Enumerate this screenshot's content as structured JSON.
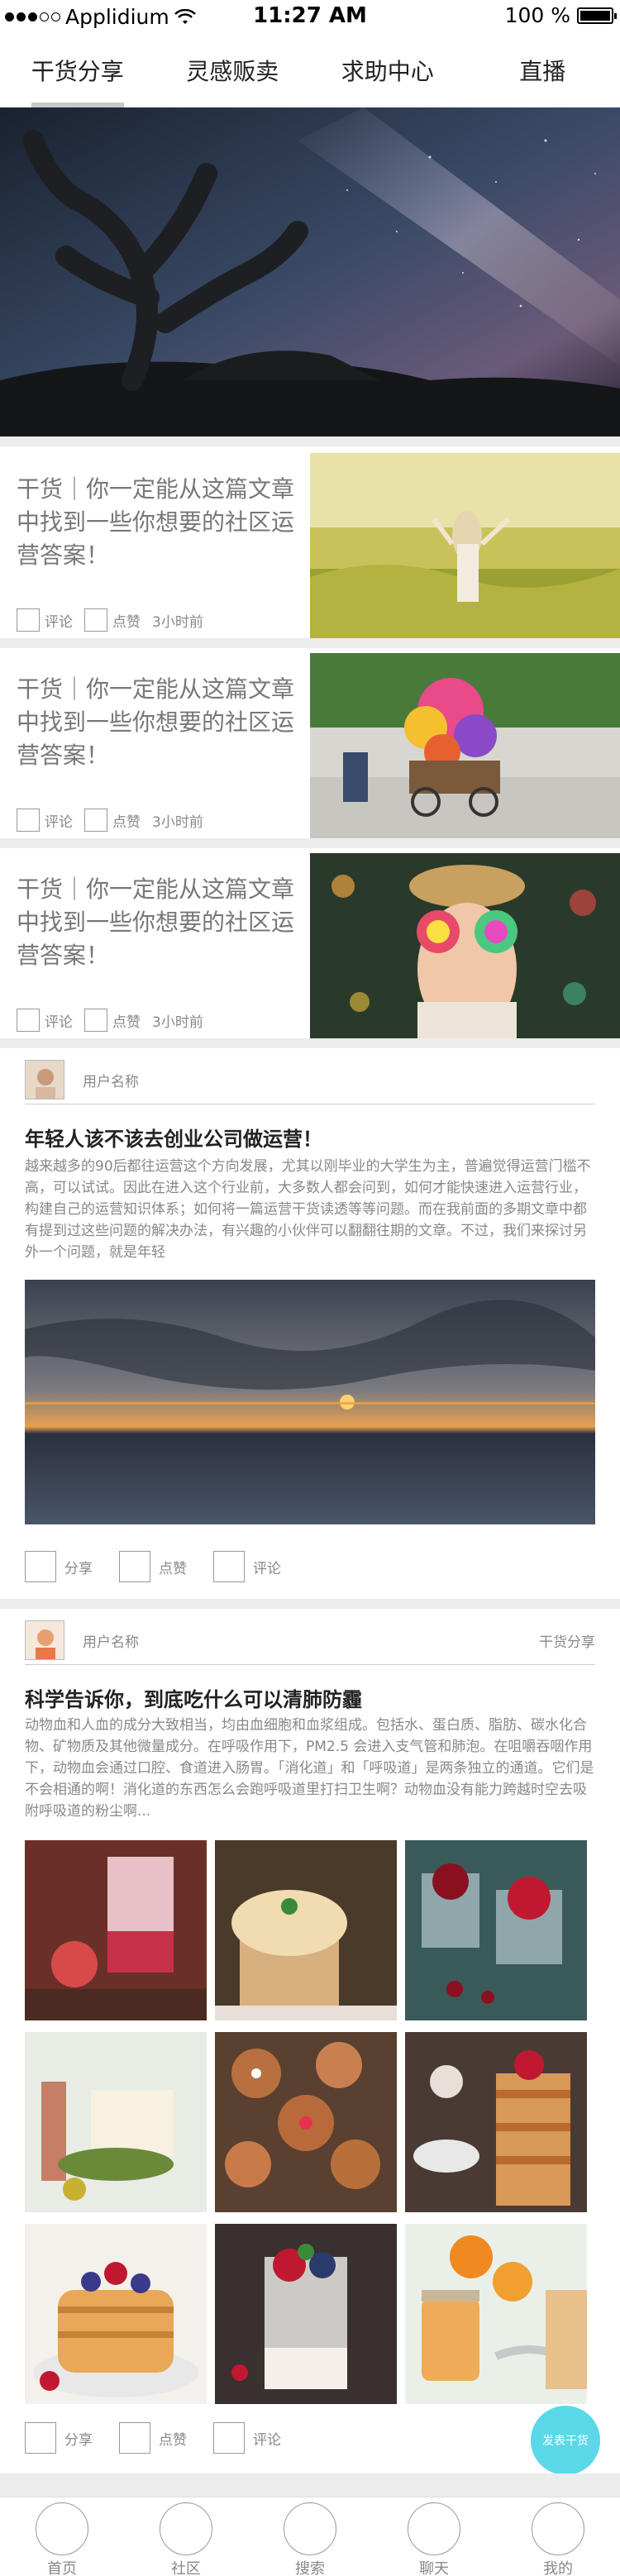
{
  "status_bar": {
    "carrier": "Applidium",
    "time": "11:27 AM",
    "battery": "100 %",
    "battery_level": 1.0
  },
  "tabs": [
    {
      "label": "干货分享",
      "active": true
    },
    {
      "label": "灵感贩卖",
      "active": false
    },
    {
      "label": "求助中心",
      "active": false
    },
    {
      "label": "直播",
      "active": false
    }
  ],
  "news": [
    {
      "title": "干货｜你一定能从这篇文章中找到一些你想要的社区运营答案！",
      "comment": "评论",
      "like": "点赞",
      "time": "3小时前"
    },
    {
      "title": "干货｜你一定能从这篇文章中找到一些你想要的社区运营答案！",
      "comment": "评论",
      "like": "点赞",
      "time": "3小时前"
    },
    {
      "title": "干货｜你一定能从这篇文章中找到一些你想要的社区运营答案！",
      "comment": "评论",
      "like": "点赞",
      "time": "3小时前"
    }
  ],
  "post1": {
    "username": "用户名称",
    "title": "年轻人该不该去创业公司做运营！",
    "body": "越来越多的90后都往运营这个方向发展，尤其以刚毕业的大学生为主，普遍觉得运营门槛不高，可以试试。因此在进入这个行业前，大多数人都会问到，如何才能快速进入运营行业，构建自己的运营知识体系；如何将一篇运营干货读透等等问题。而在我前面的多期文章中都有提到过这些问题的解决办法，有兴趣的小伙伴可以翻翻往期的文章。不过，我们来探讨另外一个问题，就是年轻",
    "share": "分享",
    "like": "点赞",
    "comment": "评论"
  },
  "post2": {
    "username": "用户名称",
    "tag": "干货分享",
    "title": "科学告诉你，到底吃什么可以清肺防霾",
    "body": "动物血和人血的成分大致相当，均由血细胞和血浆组成。包括水、蛋白质、脂肪、碳水化合物、矿物质及其他微量成分。在呼吸作用下，PM2.5 会进入支气管和肺泡。在咀嚼吞咽作用下，动物血会通过口腔、食道进入肠胃。「消化道」和「呼吸道」是两条独立的通道。它们是不会相通的啊！消化道的东西怎么会跑呼吸道里打扫卫生啊？动物血没有能力跨越时空去吸附呼吸道的粉尘啊...",
    "share": "分享",
    "like": "点赞",
    "comment": "评论"
  },
  "fab_label": "发表干货",
  "bottom_nav": [
    {
      "label": "首页"
    },
    {
      "label": "社区"
    },
    {
      "label": "搜索"
    },
    {
      "label": "聊天"
    },
    {
      "label": "我的"
    }
  ]
}
